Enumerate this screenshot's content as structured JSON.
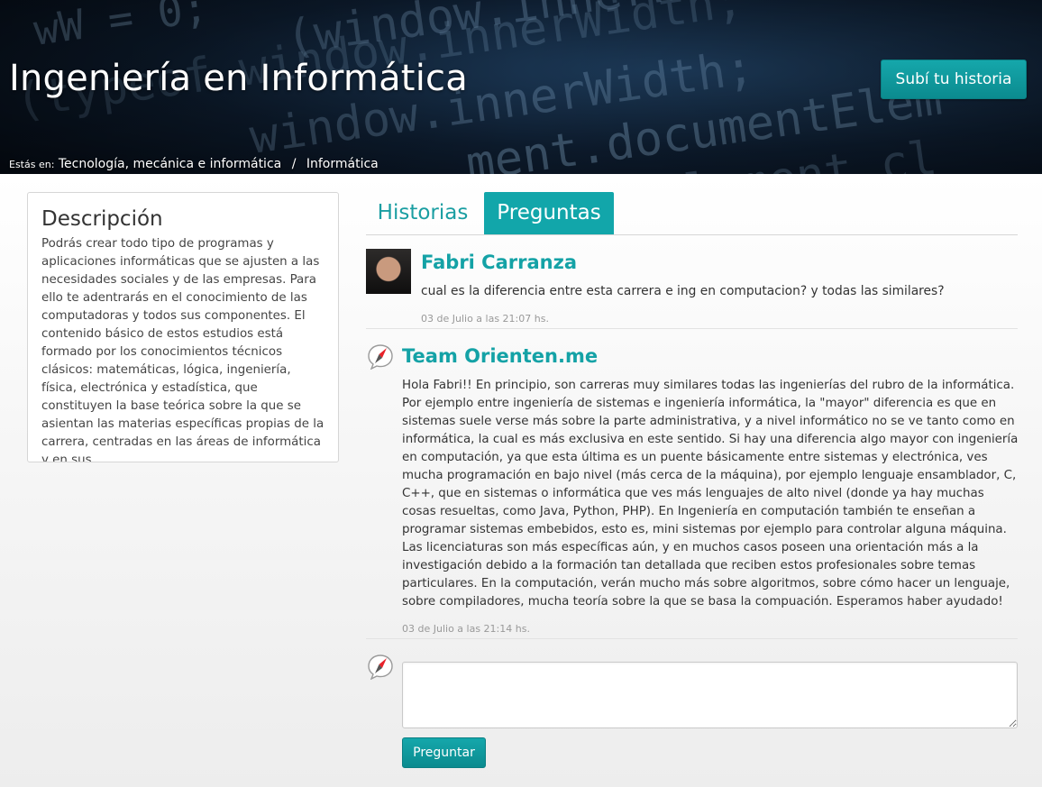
{
  "header": {
    "title": "Ingeniería en Informática",
    "cta_label": "Subí tu historia",
    "breadcrumb_prefix": "Estás en:",
    "breadcrumb": [
      "Tecnología, mecánica e informática",
      "Informática"
    ],
    "breadcrumb_separator": "/"
  },
  "description": {
    "title": "Descripción",
    "text": "Podrás crear todo tipo de programas y aplicaciones informáticas que se ajusten a las necesidades sociales y de las empresas. Para ello te adentrarás en el conocimiento de las computadoras y todos sus componentes. El contenido básico de estos estudios está formado por los conocimientos técnicos clásicos: matemáticas, lógica, ingeniería, física, electrónica y estadística, que constituyen la base teórica sobre la que se asientan las materias específicas propias de la carrera, centradas en las áreas de informática y en sus"
  },
  "tabs": [
    {
      "label": "Historias",
      "active": false
    },
    {
      "label": "Preguntas",
      "active": true
    }
  ],
  "question": {
    "author": "Fabri Carranza",
    "text": "cual es la diferencia entre esta carrera e ing en computacion? y todas las similares?",
    "timestamp": "03 de Julio a las 21:07 hs."
  },
  "answer": {
    "author": "Team Orienten.me",
    "text": "Hola Fabri!! En principio, son carreras muy similares todas las ingenierías del rubro de la informática. Por ejemplo entre ingeniería de sistemas e ingeniería informática, la \"mayor\" diferencia es que en sistemas suele verse más sobre la parte administrativa, y a nivel informático no se ve tanto como en informática, la cual es más exclusiva en este sentido. Si hay una diferencia algo mayor con ingeniería en computación, ya que esta última es un puente básicamente entre sistemas y electrónica, ves mucha programación en bajo nivel (más cerca de la máquina), por ejemplo lenguaje ensamblador, C, C++, que en sistemas o informática que ves más lenguajes de alto nivel (donde ya hay muchas cosas resueltas, como Java, Python, PHP). En Ingeniería en computación también te enseñan a programar sistemas embebidos, esto es, mini sistemas por ejemplo para controlar alguna máquina. Las licenciaturas son más específicas aún, y en muchos casos poseen una orientación más a la investigación debido a la formación tan detallada que reciben estos profesionales sobre temas particulares. En la computación, verán mucho más sobre algoritmos, sobre cómo hacer un lenguaje, sobre compiladores, mucha teoría sobre la que se basa la compuación. Esperamos haber ayudado!",
    "timestamp": "03 de Julio a las 21:14 hs."
  },
  "reply_form": {
    "placeholder": "",
    "value": "",
    "submit_label": "Preguntar"
  },
  "icons": {
    "brand": "compass-speech-bubble-icon",
    "avatar": "user-photo"
  },
  "colors": {
    "accent": "#12a6aa",
    "accent_dark": "#0b8b8f",
    "brand_red": "#e8222a",
    "timestamp": "#999999"
  }
}
